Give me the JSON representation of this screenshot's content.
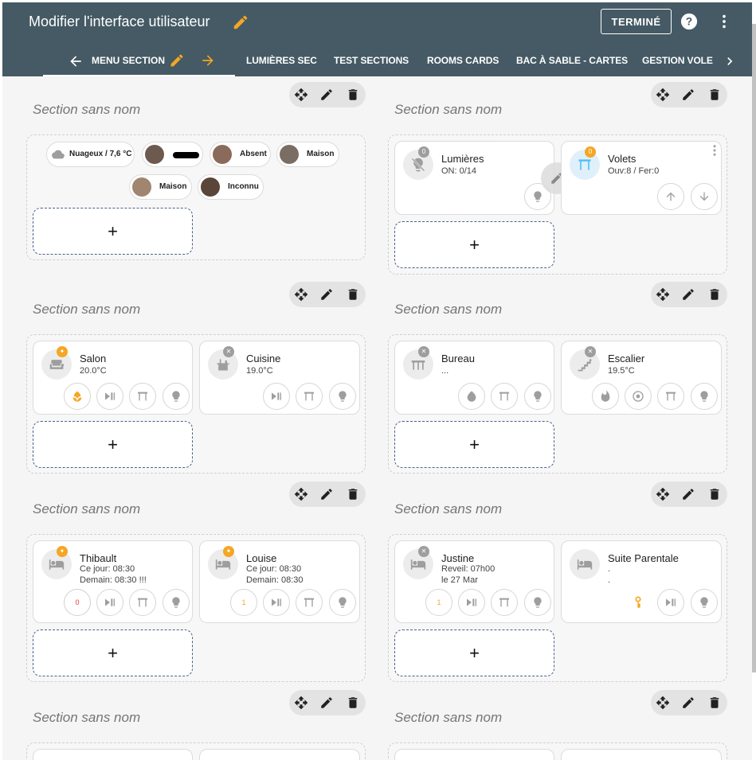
{
  "header": {
    "title": "Modifier l'interface utilisateur",
    "done_label": "TERMINÉ",
    "help": "?"
  },
  "tabs": {
    "active": "MENU SECTION",
    "items": [
      "LUMIÈRES SEC",
      "TEST SECTIONS",
      "ROOMS CARDS",
      "BAC À SABLE - CARTES",
      "GESTION VOLE"
    ]
  },
  "colors": {
    "header_bg": "#455a64",
    "accent": "#f5a623",
    "bg": "#f5f5f5"
  },
  "section_title": "Section sans nom",
  "add_label": "+",
  "presence_chips": [
    {
      "label": "Nuageux / 7,6 °C",
      "icon": "cloud-icon"
    },
    {
      "label": "",
      "avatar": "avatar-redacted"
    },
    {
      "label": "Absent"
    },
    {
      "label": "Maison"
    },
    {
      "label": "Maison"
    },
    {
      "label": "Inconnu"
    }
  ],
  "summary": {
    "lights": {
      "name": "Lumières",
      "value": "ON: 0/14",
      "badge": "0"
    },
    "shutters": {
      "name": "Volets",
      "value": "Ouv:8 / Fer:0",
      "badge": "0"
    }
  },
  "rooms": {
    "salon": {
      "name": "Salon",
      "line1": "20.0°C"
    },
    "cuisine": {
      "name": "Cuisine",
      "line1": "19.0°C"
    },
    "bureau": {
      "name": "Bureau",
      "line1": "..."
    },
    "escalier": {
      "name": "Escalier",
      "line1": "19.5°C"
    },
    "thibault": {
      "name": "Thibault",
      "line1": "Ce jour: 08:30",
      "line2": "Demain: 08:30 !!!",
      "counter": "0"
    },
    "louise": {
      "name": "Louise",
      "line1": "Ce jour: 08:30",
      "line2": "Demain: 08:30",
      "counter": "1"
    },
    "justine": {
      "name": "Justine",
      "line1": "Reveil:  07h00",
      "line2": "le 27 Mar",
      "counter": "1"
    },
    "suite": {
      "name": "Suite Parentale",
      "line1": ".",
      "line2": "."
    }
  }
}
